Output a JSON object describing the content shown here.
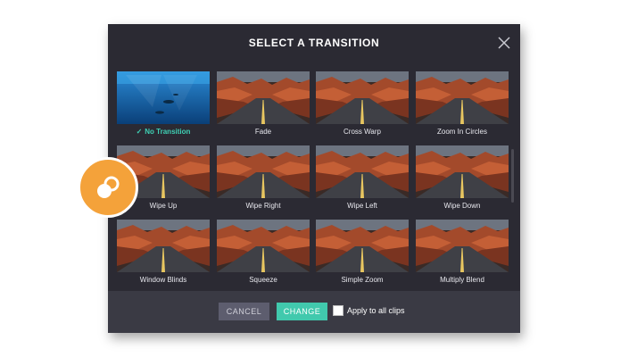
{
  "dialog": {
    "title": "SELECT A TRANSITION"
  },
  "transitions": [
    {
      "label": "No Transition",
      "selected": true,
      "thumbnail": "underwater"
    },
    {
      "label": "Fade",
      "selected": false,
      "thumbnail": "canyon-road"
    },
    {
      "label": "Cross Warp",
      "selected": false,
      "thumbnail": "canyon-road"
    },
    {
      "label": "Zoom In Circles",
      "selected": false,
      "thumbnail": "canyon-road"
    },
    {
      "label": "Wipe Up",
      "selected": false,
      "thumbnail": "canyon-road"
    },
    {
      "label": "Wipe Right",
      "selected": false,
      "thumbnail": "canyon-road"
    },
    {
      "label": "Wipe Left",
      "selected": false,
      "thumbnail": "canyon-road"
    },
    {
      "label": "Wipe Down",
      "selected": false,
      "thumbnail": "canyon-road"
    },
    {
      "label": "Window Blinds",
      "selected": false,
      "thumbnail": "canyon-road"
    },
    {
      "label": "Squeeze",
      "selected": false,
      "thumbnail": "canyon-road"
    },
    {
      "label": "Simple Zoom",
      "selected": false,
      "thumbnail": "canyon-road"
    },
    {
      "label": "Multiply Blend",
      "selected": false,
      "thumbnail": "canyon-road"
    }
  ],
  "footer": {
    "cancel_label": "CANCEL",
    "change_label": "CHANGE",
    "apply_all_label": "Apply to all clips",
    "apply_all_checked": false
  },
  "icons": {
    "close": "close-icon",
    "selected": "check-icon",
    "badge": "toggle-icon"
  },
  "colors": {
    "dialog_bg": "#2b2a33",
    "footer_bg": "#3a3a44",
    "accent": "#41c9ad",
    "selected_text": "#3fd1b5",
    "cancel_bg": "#5d5d6e",
    "badge": "#f4a23a"
  }
}
